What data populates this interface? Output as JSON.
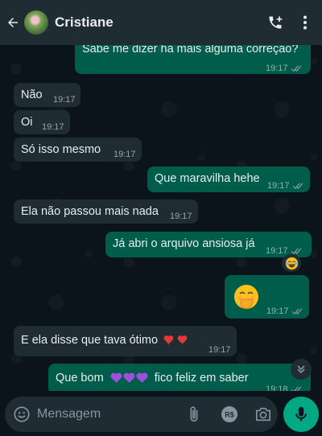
{
  "header": {
    "contact_name": "Cristiane",
    "back_icon": "arrow-left-icon",
    "call_icon": "add-call-icon",
    "menu_icon": "more-vert-icon"
  },
  "messages": [
    {
      "dir": "out",
      "text": "Sabe me dizer há mais alguma correção?",
      "time": "19:17",
      "read": true
    },
    {
      "dir": "in",
      "text": "Não",
      "time": "19:17"
    },
    {
      "dir": "in",
      "text": "Oi",
      "time": "19:17"
    },
    {
      "dir": "in",
      "text": "Só isso mesmo",
      "time": "19:17"
    },
    {
      "dir": "out",
      "text": "Que maravilha hehe",
      "time": "19:17",
      "read": true
    },
    {
      "dir": "in",
      "text": "Ela não passou mais nada",
      "time": "19:17"
    },
    {
      "dir": "out",
      "text": "Já abri o arquivo ansiosa já",
      "time": "19:17",
      "read": true,
      "reaction": "joy-emoji"
    },
    {
      "dir": "out",
      "text": "",
      "emoji": "hand-over-mouth-emoji",
      "time": "19:17",
      "read": true
    },
    {
      "dir": "in",
      "text": "E ela disse que tava ótimo",
      "emoji_suffix": "two-red-hearts",
      "time": "19:17"
    },
    {
      "dir": "out",
      "text_before": "Que bom",
      "emoji_middle": "three-purple-hearts",
      "text_after": "fico feliz em saber",
      "time": "19:18",
      "read": true
    }
  ],
  "input": {
    "placeholder": "Mensagem",
    "payment_label": "R$"
  },
  "colors": {
    "incoming_bubble": "#1f2c34",
    "outgoing_bubble": "#005c4b",
    "accent": "#00a884",
    "read_tick": "#8696a0"
  }
}
